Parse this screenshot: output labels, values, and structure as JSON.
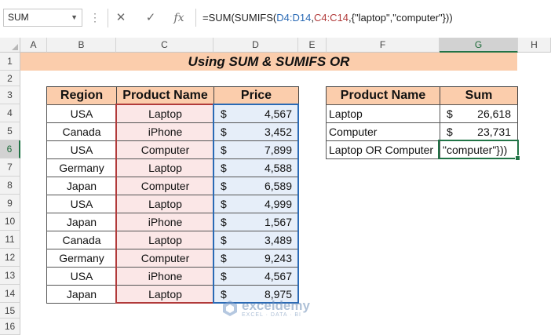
{
  "formula_bar": {
    "name_box": "SUM",
    "cancel_glyph": "✕",
    "enter_glyph": "✓",
    "fx_glyph": "fx",
    "formula_prefix": "=SUM(SUMIFS(",
    "formula_ref1": "D4:D14",
    "formula_comma": ",",
    "formula_ref2": "C4:C14",
    "formula_suffix": ",{\"laptop\",\"computer\"}))"
  },
  "columns": [
    "A",
    "B",
    "C",
    "D",
    "E",
    "F",
    "G",
    "H"
  ],
  "rows": [
    "1",
    "2",
    "3",
    "4",
    "5",
    "6",
    "7",
    "8",
    "9",
    "10",
    "11",
    "12",
    "13",
    "14",
    "15",
    "16"
  ],
  "title": "Using SUM & SUMIFS  OR",
  "table_headers": {
    "region": "Region",
    "product": "Product Name",
    "price": "Price"
  },
  "table_rows": [
    {
      "region": "USA",
      "product": "Laptop",
      "currency": "$",
      "price": "4,567"
    },
    {
      "region": "Canada",
      "product": "iPhone",
      "currency": "$",
      "price": "3,452"
    },
    {
      "region": "USA",
      "product": "Computer",
      "currency": "$",
      "price": "7,899"
    },
    {
      "region": "Germany",
      "product": "Laptop",
      "currency": "$",
      "price": "4,588"
    },
    {
      "region": "Japan",
      "product": "Computer",
      "currency": "$",
      "price": "6,589"
    },
    {
      "region": "USA",
      "product": "Laptop",
      "currency": "$",
      "price": "4,999"
    },
    {
      "region": "Japan",
      "product": "iPhone",
      "currency": "$",
      "price": "1,567"
    },
    {
      "region": "Canada",
      "product": "Laptop",
      "currency": "$",
      "price": "3,489"
    },
    {
      "region": "Germany",
      "product": "Computer",
      "currency": "$",
      "price": "9,243"
    },
    {
      "region": "USA",
      "product": "iPhone",
      "currency": "$",
      "price": "4,567"
    },
    {
      "region": "Japan",
      "product": "Laptop",
      "currency": "$",
      "price": "8,975"
    }
  ],
  "summary_headers": {
    "product": "Product Name",
    "sum": "Sum"
  },
  "summary_rows": [
    {
      "product": "Laptop",
      "currency": "$",
      "sum": "26,618"
    },
    {
      "product": "Computer",
      "currency": "$",
      "sum": "23,731"
    },
    {
      "product": "Laptop OR Computer",
      "currency": "",
      "sum": "\"computer\"}))"
    }
  ],
  "selected_cell": "G6",
  "watermark": {
    "name": "exceldemy",
    "tagline": "EXCEL · DATA · BI"
  },
  "colors": {
    "header_fill": "#fbcdac",
    "selection": "#217346",
    "product_ref": "#b13a3a",
    "price_ref": "#2a6ab5"
  }
}
